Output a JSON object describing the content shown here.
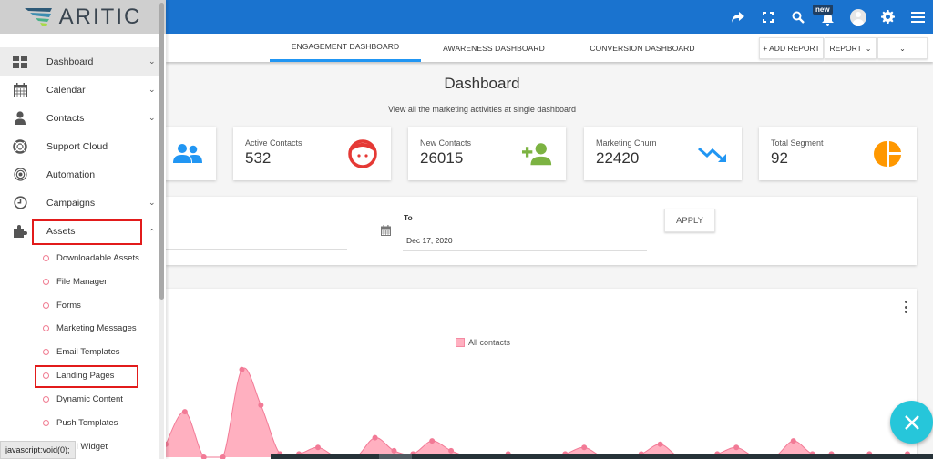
{
  "app": {
    "logo_text": "ARITIC",
    "notification_badge": "new"
  },
  "colors": {
    "topbar": "#1a73cf",
    "tab_active": "#2196f3",
    "series_fill": "#ffb0c0",
    "series_stroke": "#f27a96",
    "fab": "#26c6da",
    "highlight_box": "#e21b1b"
  },
  "topbar_icons": [
    "share-icon",
    "fullscreen-icon",
    "search-icon",
    "bell-icon",
    "avatar-icon",
    "gear-icon",
    "menu-icon"
  ],
  "tabs": [
    {
      "label": "ENGAGEMENT DASHBOARD",
      "active": true
    },
    {
      "label": "AWARENESS DASHBOARD",
      "active": false
    },
    {
      "label": "CONVERSION DASHBOARD",
      "active": false
    }
  ],
  "toolbar": {
    "add_report_label": "+ ADD REPORT",
    "report_label": "REPORT",
    "dropdown_label": ""
  },
  "page": {
    "title": "Dashboard",
    "subtitle": "View all the marketing activities at single dashboard"
  },
  "stats": [
    {
      "label": "",
      "value": "",
      "icon": "users-icon",
      "color": "#2196f3"
    },
    {
      "label": "Active Contacts",
      "value": "532",
      "icon": "face-icon",
      "color": "#e53935"
    },
    {
      "label": "New Contacts",
      "value": "26015",
      "icon": "add-user-icon",
      "color": "#7cb342"
    },
    {
      "label": "Marketing Churn",
      "value": "22420",
      "icon": "trending-down-icon",
      "color": "#2196f3"
    },
    {
      "label": "Total Segment",
      "value": "92",
      "icon": "pie-chart-icon",
      "color": "#ff9800"
    }
  ],
  "filter": {
    "to_label": "To",
    "to_value": "Dec 17, 2020",
    "apply_label": "APPLY"
  },
  "sidebar": {
    "items": [
      {
        "label": "Dashboard",
        "icon": "dashboard-icon",
        "chevron": "down",
        "highlight": true
      },
      {
        "label": "Calendar",
        "icon": "calendar-icon",
        "chevron": "down"
      },
      {
        "label": "Contacts",
        "icon": "contact-icon",
        "chevron": "down"
      },
      {
        "label": "Support Cloud",
        "icon": "lifebuoy-icon",
        "chevron": ""
      },
      {
        "label": "Automation",
        "icon": "target-icon",
        "chevron": ""
      },
      {
        "label": "Campaigns",
        "icon": "clock-icon",
        "chevron": "down"
      },
      {
        "label": "Assets",
        "icon": "puzzle-icon",
        "chevron": "up",
        "boxed": true
      }
    ],
    "sub_items": [
      {
        "label": "Downloadable Assets"
      },
      {
        "label": "File Manager"
      },
      {
        "label": "Forms"
      },
      {
        "label": "Marketing Messages"
      },
      {
        "label": "Email Templates"
      },
      {
        "label": "Landing Pages",
        "boxed": true
      },
      {
        "label": "Dynamic Content"
      },
      {
        "label": "Push Templates"
      },
      {
        "label": "Email Widget"
      }
    ]
  },
  "status_bar": {
    "text": "javascript:void(0);"
  },
  "chart_data": {
    "type": "area",
    "title": "",
    "legend": [
      "All contacts"
    ],
    "legend_position": "top",
    "series": [
      {
        "name": "All contacts",
        "values": [
          4,
          14,
          0,
          0,
          27,
          16,
          1,
          1,
          3,
          0,
          0,
          6,
          2,
          1,
          5,
          2,
          0,
          0,
          1,
          0,
          0,
          1,
          3,
          0,
          0,
          1,
          4,
          0,
          0,
          1,
          3,
          0,
          0,
          5,
          1,
          1,
          0,
          1,
          0,
          1
        ]
      }
    ],
    "ylim": [
      0,
      30
    ],
    "grid": false
  }
}
